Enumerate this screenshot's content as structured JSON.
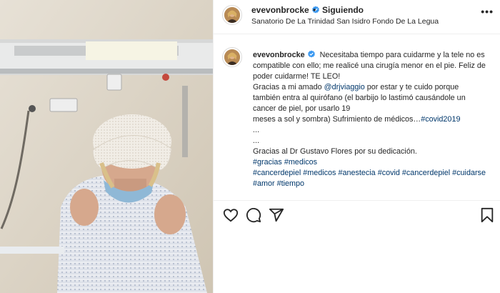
{
  "post": {
    "username": "evevonbrocke",
    "verified": true,
    "follow_status": "Siguiendo",
    "separator": "•",
    "more_label": "•••",
    "location": "Sanatorio De La Trinidad San Isidro Fondo De La Legua"
  },
  "caption": {
    "lines": [
      "Necesitaba tiempo para cuidarme y la tele no es",
      "compatible con ello; me realicé una cirugía menor en el pie. Feliz de",
      "poder cuidarme! TE LEO!",
      "Gracias a mi amado",
      "@drjviaggio",
      "por estar y te cuido porque",
      "también entra al quirófano (el barbijo lo lastimó causándole un",
      "cancer de piel, por usarlo 19",
      "meses a sol y sombra) Sufrimiento de médicos…",
      "#covid2019",
      "...",
      "...",
      "Gracias al Dr Gustavo Flores por su dedicación.",
      "#gracias",
      "#medicos",
      "#cancerdepiel",
      "#medicos",
      "#anestecia",
      "#covid",
      "#cancerdepiel",
      "#cuidarse",
      "#amor",
      "#tiempo"
    ]
  },
  "icons": {
    "like": "heart-icon",
    "comment": "comment-icon",
    "share": "share-icon",
    "save": "bookmark-icon",
    "verified": "verified-badge-icon"
  },
  "colors": {
    "link": "#00376b",
    "verified": "#3897f0",
    "text": "#262626"
  }
}
